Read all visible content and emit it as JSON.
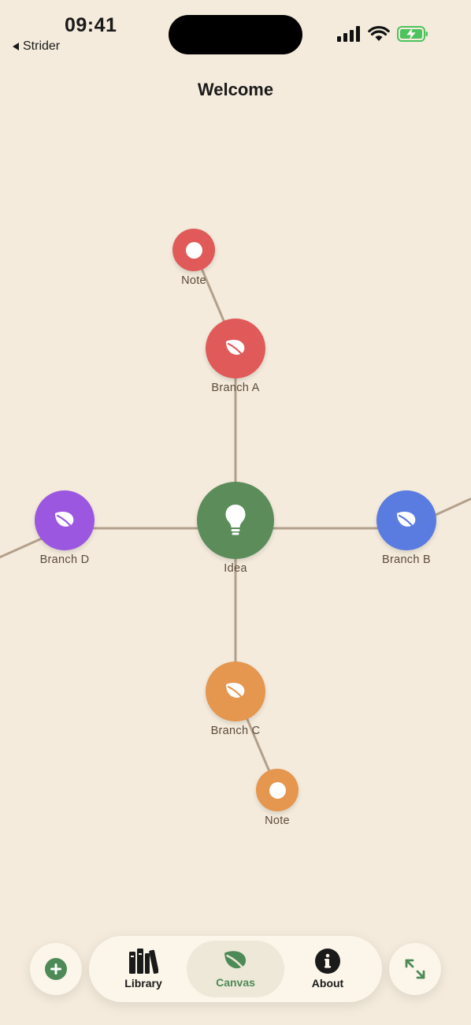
{
  "status_bar": {
    "time": "09:41",
    "back_app": "Strider"
  },
  "header": {
    "title": "Welcome"
  },
  "colors": {
    "background": "#F4EBDC",
    "idea": "#5B8C5A",
    "branch_a": "#E05A5A",
    "branch_b": "#5A7BE0",
    "branch_c": "#E5964F",
    "branch_d": "#9C57E0",
    "edge": "#B3A08C",
    "accent": "#4E8A57"
  },
  "canvas": {
    "root": {
      "label": "Idea",
      "icon": "lightbulb-icon"
    },
    "branches": [
      {
        "key": "a",
        "label": "Branch A",
        "icon": "leaf-icon"
      },
      {
        "key": "b",
        "label": "Branch B",
        "icon": "leaf-icon"
      },
      {
        "key": "c",
        "label": "Branch C",
        "icon": "leaf-icon"
      },
      {
        "key": "d",
        "label": "Branch D",
        "icon": "leaf-icon"
      }
    ],
    "notes": [
      {
        "parent": "Branch A",
        "label": "Note"
      },
      {
        "parent": "Branch C",
        "label": "Note"
      }
    ]
  },
  "tabbar": {
    "tabs": [
      {
        "label": "Library",
        "icon": "books-icon",
        "active": false
      },
      {
        "label": "Canvas",
        "icon": "leaf-icon",
        "active": true
      },
      {
        "label": "About",
        "icon": "info-icon",
        "active": false
      }
    ],
    "add_button_icon": "plus-icon",
    "fit_button_icon": "expand-arrows-icon"
  }
}
